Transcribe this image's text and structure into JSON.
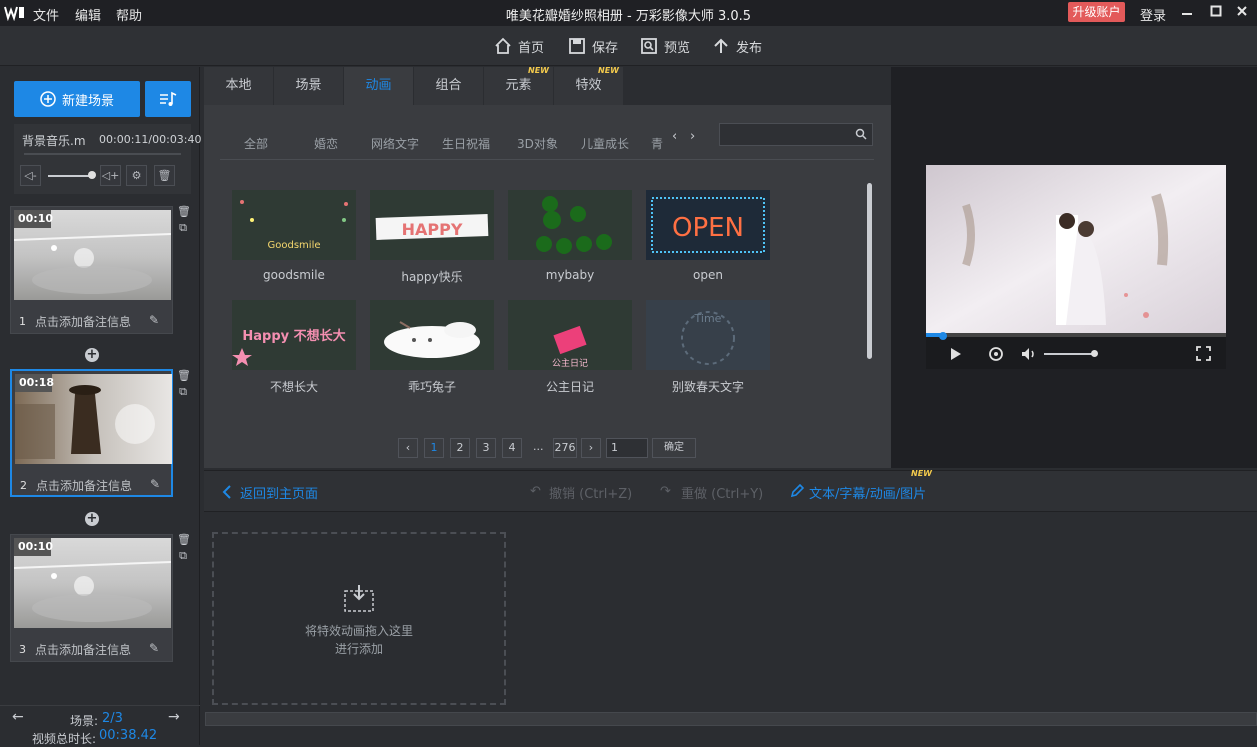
{
  "app": {
    "logo": "W",
    "title": "唯美花瓣婚纱照相册 - 万彩影像大师 3.0.5",
    "menu": [
      "文件",
      "编辑",
      "帮助"
    ],
    "upgrade": "升级账户",
    "login": "登录"
  },
  "toolbar": {
    "home": "首页",
    "save": "保存",
    "preview": "预览",
    "publish": "发布"
  },
  "left": {
    "new_scene": "新建场景",
    "bgm_name": "背景音乐.m",
    "bgm_time": "00:00:11/00:03:40",
    "scenes": [
      {
        "num": "1",
        "duration": "00:10",
        "note": "点击添加备注信息"
      },
      {
        "num": "2",
        "duration": "00:18",
        "note": "点击添加备注信息"
      },
      {
        "num": "3",
        "duration": "00:10",
        "note": "点击添加备注信息"
      }
    ],
    "scene_count_label": "场景:",
    "scene_count_value": "2/3",
    "total_label": "视频总时长:",
    "total_value": "00:38.42"
  },
  "tabs": [
    {
      "label": "本地",
      "badge": ""
    },
    {
      "label": "场景",
      "badge": ""
    },
    {
      "label": "动画",
      "badge": ""
    },
    {
      "label": "组合",
      "badge": ""
    },
    {
      "label": "元素",
      "badge": "NEW"
    },
    {
      "label": "特效",
      "badge": "NEW"
    }
  ],
  "categories": [
    "全部",
    "婚恋",
    "网络文字",
    "生日祝福",
    "3D对象",
    "儿童成长",
    "青"
  ],
  "assets": [
    {
      "label": "goodsmile",
      "thumb_text": "Goodsmile"
    },
    {
      "label": "happy快乐",
      "thumb_text": "HAPPY"
    },
    {
      "label": "mybaby",
      "thumb_text": ""
    },
    {
      "label": "open",
      "thumb_text": "OPEN"
    },
    {
      "label": "不想长大",
      "thumb_text": "Happy 不想长大"
    },
    {
      "label": "乖巧兔子",
      "thumb_text": ""
    },
    {
      "label": "公主日记",
      "thumb_text": "公主日记"
    },
    {
      "label": "别致春天文字",
      "thumb_text": "Time"
    }
  ],
  "pagination": {
    "pages": [
      "1",
      "2",
      "3",
      "4",
      "...",
      "276"
    ],
    "input": "1",
    "confirm": "确定"
  },
  "bottom": {
    "back": "返回到主页面",
    "undo": "撤销 (Ctrl+Z)",
    "redo": "重做 (Ctrl+Y)",
    "text_tool": "文本/字幕/动画/图片",
    "text_tool_badge": "NEW",
    "drop_line1": "将特效动画拖入这里",
    "drop_line2": "进行添加"
  },
  "colors": {
    "accent": "#1e88e5",
    "upgrade": "#e35a5a",
    "badge": "#f2c94c"
  }
}
